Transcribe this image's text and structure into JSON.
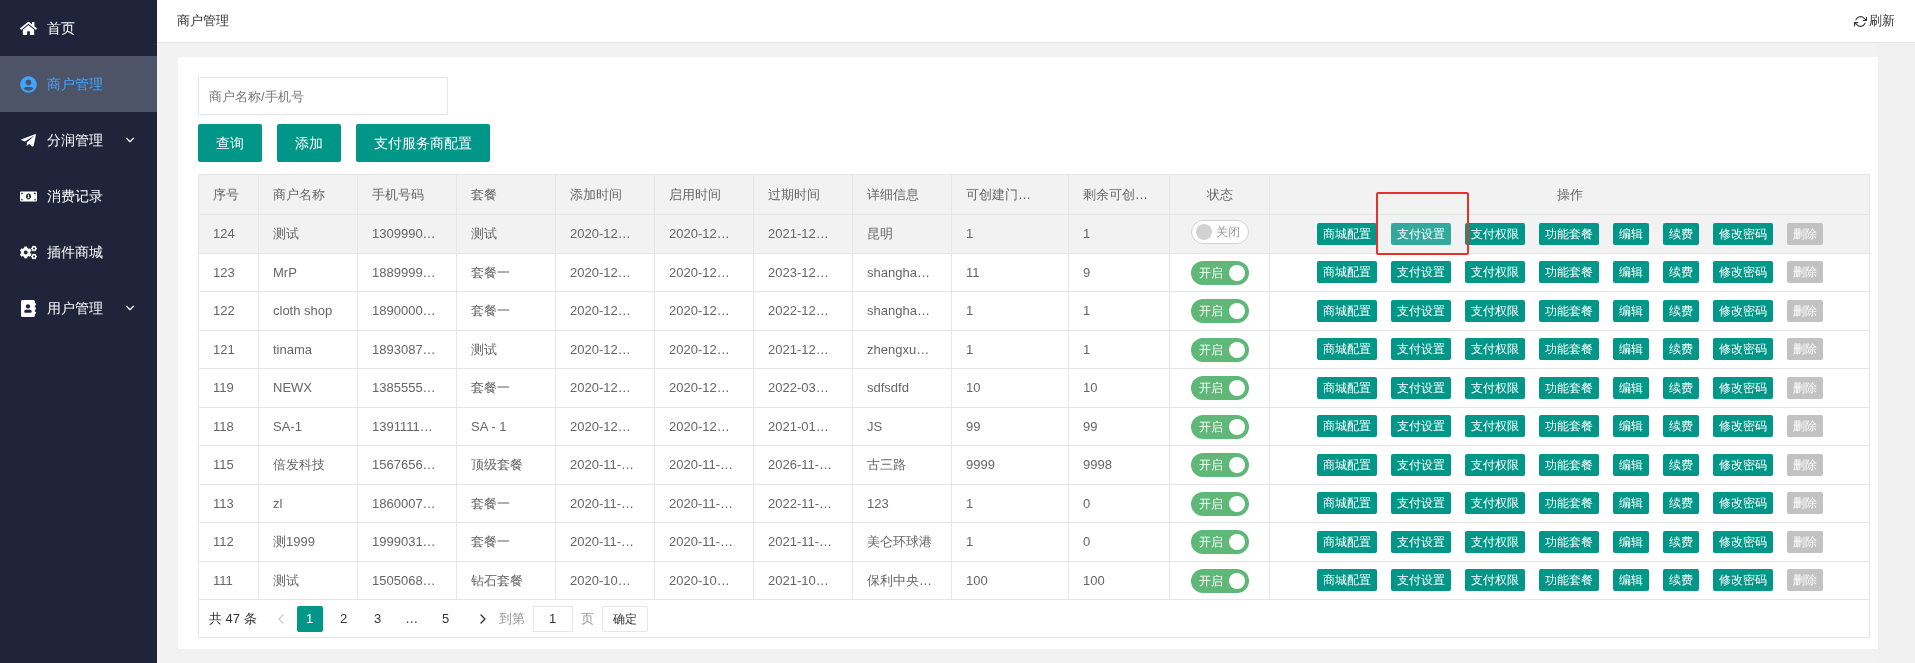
{
  "sidebar": {
    "items": [
      {
        "label": "首页",
        "selected": false,
        "expandable": false
      },
      {
        "label": "商户管理",
        "selected": true,
        "expandable": false
      },
      {
        "label": "分润管理",
        "selected": false,
        "expandable": true
      },
      {
        "label": "消费记录",
        "selected": false,
        "expandable": false
      },
      {
        "label": "插件商城",
        "selected": false,
        "expandable": false
      },
      {
        "label": "用户管理",
        "selected": false,
        "expandable": true
      }
    ]
  },
  "header": {
    "title": "商户管理",
    "refresh": "刷新"
  },
  "search": {
    "placeholder": "商户名称/手机号"
  },
  "toolbar": [
    "查询",
    "添加",
    "支付服务商配置"
  ],
  "table": {
    "columns": [
      "序号",
      "商户名称",
      "手机号码",
      "套餐",
      "添加时间",
      "启用时间",
      "过期时间",
      "详细信息",
      "可创建门…",
      "剩余可创…",
      "状态",
      "操作"
    ],
    "rows": [
      {
        "highlighted": true,
        "cells": [
          "124",
          "测试",
          "1309990…",
          "测试",
          "2020-12…",
          "2020-12…",
          "2021-12…",
          "昆明",
          "1",
          "1"
        ],
        "status": {
          "on": false,
          "label": "关闭"
        },
        "actions": [
          {
            "label": "商城配置",
            "disabled": false
          },
          {
            "label": "支付设置",
            "disabled": false
          },
          {
            "label": "支付权限",
            "disabled": false
          },
          {
            "label": "功能套餐",
            "disabled": false
          },
          {
            "label": "编辑",
            "disabled": false
          },
          {
            "label": "续费",
            "disabled": false
          },
          {
            "label": "修改密码",
            "disabled": false
          },
          {
            "label": "删除",
            "disabled": true
          }
        ]
      },
      {
        "highlighted": false,
        "cells": [
          "123",
          "MrP",
          "1889999…",
          "套餐一",
          "2020-12…",
          "2020-12…",
          "2023-12…",
          "shangha…",
          "11",
          "9"
        ],
        "status": {
          "on": true,
          "label": "开启"
        },
        "actions": [
          {
            "label": "商城配置",
            "disabled": false
          },
          {
            "label": "支付设置",
            "disabled": false
          },
          {
            "label": "支付权限",
            "disabled": false
          },
          {
            "label": "功能套餐",
            "disabled": false
          },
          {
            "label": "编辑",
            "disabled": false
          },
          {
            "label": "续费",
            "disabled": false
          },
          {
            "label": "修改密码",
            "disabled": false
          },
          {
            "label": "删除",
            "disabled": true
          }
        ]
      },
      {
        "highlighted": false,
        "cells": [
          "122",
          "cloth shop",
          "1890000…",
          "套餐一",
          "2020-12…",
          "2020-12…",
          "2022-12…",
          "shangha…",
          "1",
          "1"
        ],
        "status": {
          "on": true,
          "label": "开启"
        },
        "actions": [
          {
            "label": "商城配置",
            "disabled": false
          },
          {
            "label": "支付设置",
            "disabled": false
          },
          {
            "label": "支付权限",
            "disabled": false
          },
          {
            "label": "功能套餐",
            "disabled": false
          },
          {
            "label": "编辑",
            "disabled": false
          },
          {
            "label": "续费",
            "disabled": false
          },
          {
            "label": "修改密码",
            "disabled": false
          },
          {
            "label": "删除",
            "disabled": true
          }
        ]
      },
      {
        "highlighted": false,
        "cells": [
          "121",
          "tinama",
          "1893087…",
          "测试",
          "2020-12…",
          "2020-12…",
          "2021-12…",
          "zhengxu…",
          "1",
          "1"
        ],
        "status": {
          "on": true,
          "label": "开启"
        },
        "actions": [
          {
            "label": "商城配置",
            "disabled": false
          },
          {
            "label": "支付设置",
            "disabled": false
          },
          {
            "label": "支付权限",
            "disabled": false
          },
          {
            "label": "功能套餐",
            "disabled": false
          },
          {
            "label": "编辑",
            "disabled": false
          },
          {
            "label": "续费",
            "disabled": false
          },
          {
            "label": "修改密码",
            "disabled": false
          },
          {
            "label": "删除",
            "disabled": true
          }
        ]
      },
      {
        "highlighted": false,
        "cells": [
          "119",
          "NEWX",
          "1385555…",
          "套餐一",
          "2020-12…",
          "2020-12…",
          "2022-03…",
          "sdfsdfd",
          "10",
          "10"
        ],
        "status": {
          "on": true,
          "label": "开启"
        },
        "actions": [
          {
            "label": "商城配置",
            "disabled": false
          },
          {
            "label": "支付设置",
            "disabled": false
          },
          {
            "label": "支付权限",
            "disabled": false
          },
          {
            "label": "功能套餐",
            "disabled": false
          },
          {
            "label": "编辑",
            "disabled": false
          },
          {
            "label": "续费",
            "disabled": false
          },
          {
            "label": "修改密码",
            "disabled": false
          },
          {
            "label": "删除",
            "disabled": true
          }
        ]
      },
      {
        "highlighted": false,
        "cells": [
          "118",
          "SA-1",
          "1391111…",
          "SA - 1",
          "2020-12…",
          "2020-12…",
          "2021-01…",
          "JS",
          "99",
          "99"
        ],
        "status": {
          "on": true,
          "label": "开启"
        },
        "actions": [
          {
            "label": "商城配置",
            "disabled": false
          },
          {
            "label": "支付设置",
            "disabled": false
          },
          {
            "label": "支付权限",
            "disabled": false
          },
          {
            "label": "功能套餐",
            "disabled": false
          },
          {
            "label": "编辑",
            "disabled": false
          },
          {
            "label": "续费",
            "disabled": false
          },
          {
            "label": "修改密码",
            "disabled": false
          },
          {
            "label": "删除",
            "disabled": true
          }
        ]
      },
      {
        "highlighted": false,
        "cells": [
          "115",
          "倍发科技",
          "1567656…",
          "顶级套餐",
          "2020-11-…",
          "2020-11-…",
          "2026-11-…",
          "古三路",
          "9999",
          "9998"
        ],
        "status": {
          "on": true,
          "label": "开启"
        },
        "actions": [
          {
            "label": "商城配置",
            "disabled": false
          },
          {
            "label": "支付设置",
            "disabled": false
          },
          {
            "label": "支付权限",
            "disabled": false
          },
          {
            "label": "功能套餐",
            "disabled": false
          },
          {
            "label": "编辑",
            "disabled": false
          },
          {
            "label": "续费",
            "disabled": false
          },
          {
            "label": "修改密码",
            "disabled": false
          },
          {
            "label": "删除",
            "disabled": true
          }
        ]
      },
      {
        "highlighted": false,
        "cells": [
          "113",
          "zl",
          "1860007…",
          "套餐一",
          "2020-11-…",
          "2020-11-…",
          "2022-11-…",
          "123",
          "1",
          "0"
        ],
        "status": {
          "on": true,
          "label": "开启"
        },
        "actions": [
          {
            "label": "商城配置",
            "disabled": false
          },
          {
            "label": "支付设置",
            "disabled": false
          },
          {
            "label": "支付权限",
            "disabled": false
          },
          {
            "label": "功能套餐",
            "disabled": false
          },
          {
            "label": "编辑",
            "disabled": false
          },
          {
            "label": "续费",
            "disabled": false
          },
          {
            "label": "修改密码",
            "disabled": false
          },
          {
            "label": "删除",
            "disabled": true
          }
        ]
      },
      {
        "highlighted": false,
        "cells": [
          "112",
          "测1999",
          "1999031…",
          "套餐一",
          "2020-11-…",
          "2020-11-…",
          "2021-11-…",
          "美仑环球港",
          "1",
          "0"
        ],
        "status": {
          "on": true,
          "label": "开启"
        },
        "actions": [
          {
            "label": "商城配置",
            "disabled": false
          },
          {
            "label": "支付设置",
            "disabled": false
          },
          {
            "label": "支付权限",
            "disabled": false
          },
          {
            "label": "功能套餐",
            "disabled": false
          },
          {
            "label": "编辑",
            "disabled": false
          },
          {
            "label": "续费",
            "disabled": false
          },
          {
            "label": "修改密码",
            "disabled": false
          },
          {
            "label": "删除",
            "disabled": true
          }
        ]
      },
      {
        "highlighted": false,
        "cells": [
          "111",
          "测试",
          "1505068…",
          "钻石套餐",
          "2020-10…",
          "2020-10…",
          "2021-10…",
          "保利中央…",
          "100",
          "100"
        ],
        "status": {
          "on": true,
          "label": "开启"
        },
        "actions": [
          {
            "label": "商城配置",
            "disabled": false
          },
          {
            "label": "支付设置",
            "disabled": false
          },
          {
            "label": "支付权限",
            "disabled": false
          },
          {
            "label": "功能套餐",
            "disabled": false
          },
          {
            "label": "编辑",
            "disabled": false
          },
          {
            "label": "续费",
            "disabled": false
          },
          {
            "label": "修改密码",
            "disabled": false
          },
          {
            "label": "删除",
            "disabled": true
          }
        ]
      }
    ]
  },
  "pagination": {
    "total": "共 47 条",
    "pages": [
      {
        "label": "1",
        "selected": true
      },
      {
        "label": "2",
        "selected": false
      },
      {
        "label": "3",
        "selected": false
      },
      {
        "label": "…",
        "selected": false
      },
      {
        "label": "5",
        "selected": false
      }
    ],
    "goto_label": "到第",
    "goto_value": "1",
    "page_unit": "页",
    "confirm": "确定"
  }
}
